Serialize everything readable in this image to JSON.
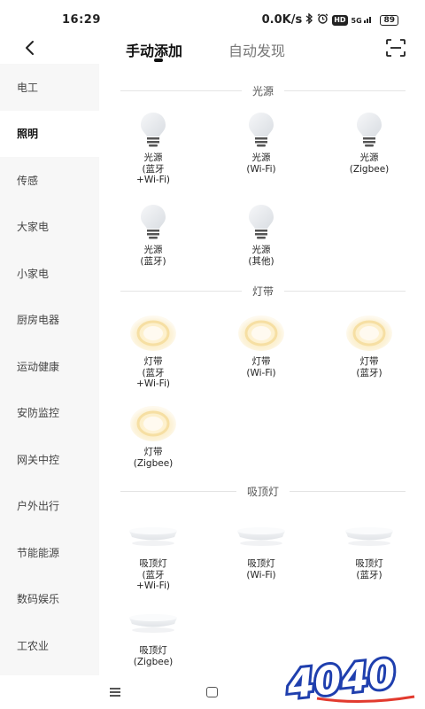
{
  "status": {
    "time": "16:29",
    "speed": "0.0K/s",
    "network": "5G",
    "hd": "HD",
    "battery": "89"
  },
  "header": {
    "tabs": [
      "手动添加",
      "自动发现"
    ],
    "active_tab": 0
  },
  "sidebar": {
    "items": [
      {
        "label": "电工"
      },
      {
        "label": "照明"
      },
      {
        "label": "传感"
      },
      {
        "label": "大家电"
      },
      {
        "label": "小家电"
      },
      {
        "label": "厨房电器"
      },
      {
        "label": "运动健康"
      },
      {
        "label": "安防监控"
      },
      {
        "label": "网关中控"
      },
      {
        "label": "户外出行"
      },
      {
        "label": "节能能源"
      },
      {
        "label": "数码娱乐"
      },
      {
        "label": "工农业"
      }
    ],
    "active_index": 1
  },
  "sections": [
    {
      "title": "光源",
      "devices": [
        {
          "label": "光源\n(蓝牙\n+Wi-Fi)",
          "icon": "bulb-icon"
        },
        {
          "label": "光源\n(Wi-Fi)",
          "icon": "bulb-icon"
        },
        {
          "label": "光源\n(Zigbee)",
          "icon": "bulb-icon"
        },
        {
          "label": "光源\n(蓝牙)",
          "icon": "bulb-icon"
        },
        {
          "label": "光源\n(其他)",
          "icon": "bulb-icon"
        }
      ]
    },
    {
      "title": "灯带",
      "devices": [
        {
          "label": "灯带\n(蓝牙\n+Wi-Fi)",
          "icon": "light-strip-icon"
        },
        {
          "label": "灯带\n(Wi-Fi)",
          "icon": "light-strip-icon"
        },
        {
          "label": "灯带\n(蓝牙)",
          "icon": "light-strip-icon"
        },
        {
          "label": "灯带\n(Zigbee)",
          "icon": "light-strip-icon"
        }
      ]
    },
    {
      "title": "吸顶灯",
      "devices": [
        {
          "label": "吸顶灯\n(蓝牙\n+Wi-Fi)",
          "icon": "ceiling-light-icon"
        },
        {
          "label": "吸顶灯\n(Wi-Fi)",
          "icon": "ceiling-light-icon"
        },
        {
          "label": "吸顶灯\n(蓝牙)",
          "icon": "ceiling-light-icon"
        },
        {
          "label": "吸顶灯\n(Zigbee)",
          "icon": "ceiling-light-icon"
        }
      ]
    }
  ],
  "watermark": {
    "text": "4040"
  },
  "colors": {
    "sidebar_bg": "#f7f7f7",
    "strip_glow": "#fde9b8",
    "bulb_body": "#e9ecef",
    "watermark": "#1f3fae"
  }
}
